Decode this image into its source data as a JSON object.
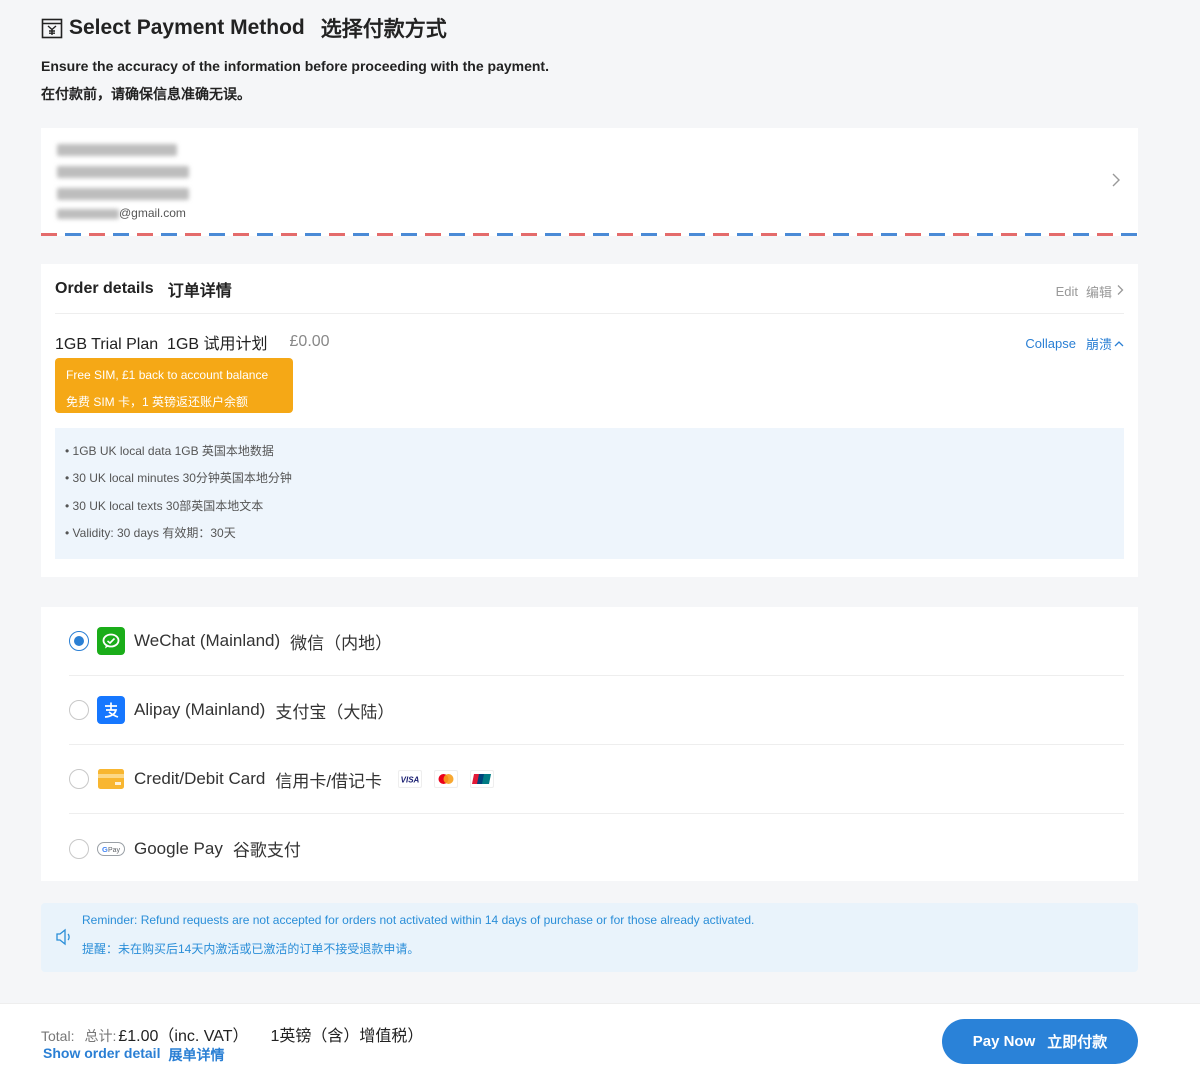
{
  "header": {
    "title": "Select Payment Method",
    "title_cn": "选择付款方式",
    "subtitle": "Ensure the accuracy of the information before proceeding with the payment.",
    "subtitle_cn": "在付款前，请确保信息准确无误。"
  },
  "address": {
    "email_suffix": "@gmail.com",
    "redacted_lines": 3
  },
  "order": {
    "title": "Order details",
    "title_cn": "订单详情",
    "edit_label": "Edit",
    "edit_label_cn": "编辑",
    "plan_name": "1GB Trial Plan",
    "plan_name_cn": "1GB 试用计划",
    "plan_price": "£0.00",
    "collapse_label": "Collapse",
    "collapse_label_cn": "崩溃",
    "promo_line1": "Free SIM, £1 back to account balance",
    "promo_line2": "免费 SIM 卡，1 英镑返还账户余额",
    "features": [
      "• 1GB UK local data  1GB 英国本地数据",
      "• 30 UK local minutes  30分钟英国本地分钟",
      "• 30 UK local texts  30部英国本地文本",
      "• Validity: 30 days  有效期：30天"
    ]
  },
  "payment_methods": [
    {
      "label": "WeChat (Mainland)",
      "label_cn": "微信（内地）",
      "icon": "wechat-icon",
      "selected": true
    },
    {
      "label": "Alipay (Mainland)",
      "label_cn": "支付宝（大陆）",
      "icon": "alipay-icon",
      "selected": false
    },
    {
      "label": "Credit/Debit Card",
      "label_cn": "信用卡/借记卡",
      "icon": "card-icon",
      "selected": false,
      "brands": [
        "VISA",
        "mastercard",
        "unionpay"
      ]
    },
    {
      "label": "Google Pay",
      "label_cn": "谷歌支付",
      "icon": "google-pay-icon",
      "selected": false
    }
  ],
  "reminder": {
    "text": "Reminder: Refund requests are not accepted for orders not activated within 14 days of purchase or for those already activated.",
    "text_cn": "提醒：未在购买后14天内激活或已激活的订单不接受退款申请。"
  },
  "footer": {
    "total_label": "Total:",
    "total_label_cn": "总计:",
    "total_amount": "£1.00（inc. VAT）",
    "total_amount_cn": "1英镑（含）增值税）",
    "show_detail": "Show order detail",
    "show_detail_cn": "展单详情",
    "pay_label": "Pay Now",
    "pay_label_cn": "立即付款"
  },
  "colors": {
    "accent": "#2a7fd4",
    "promo": "#f5a816",
    "wechat": "#1aad19",
    "alipay": "#1677ff",
    "reminder_bg": "#e9f3fb"
  }
}
